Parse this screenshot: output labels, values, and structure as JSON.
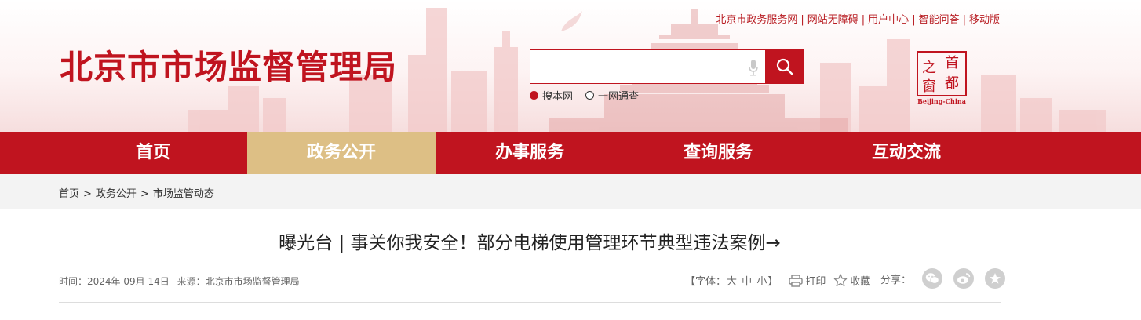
{
  "header": {
    "site_title": "北京市市场监督管理局",
    "top_links": [
      "北京市政务服务网",
      "网站无障碍",
      "用户中心",
      "智能问答",
      "移动版"
    ],
    "search": {
      "placeholder": "",
      "scopes": [
        {
          "label": "搜本网",
          "selected": true
        },
        {
          "label": "一网通查",
          "selected": false
        }
      ]
    },
    "capital_logo": {
      "chars": [
        "首",
        "都",
        "之",
        "窗"
      ],
      "caption": "Beijing-China"
    }
  },
  "nav": {
    "items": [
      {
        "label": "首页",
        "active": false
      },
      {
        "label": "政务公开",
        "active": true
      },
      {
        "label": "办事服务",
        "active": false
      },
      {
        "label": "查询服务",
        "active": false
      },
      {
        "label": "互动交流",
        "active": false
      }
    ]
  },
  "breadcrumb": {
    "items": [
      "首页",
      "政务公开",
      "市场监管动态"
    ],
    "separator": ">"
  },
  "article": {
    "title": "曝光台 | 事关你我安全！部分电梯使用管理环节典型违法案例→",
    "time_label": "时间：",
    "time_value": "2024年 09月 14日",
    "source_label": "来源：",
    "source_value": "北京市市场监督管理局"
  },
  "tools": {
    "font_prefix": "【字体：",
    "font_sizes": [
      "大",
      "中",
      "小"
    ],
    "font_suffix": "】",
    "print_label": "打印",
    "favorite_label": "收藏",
    "share_label": "分享："
  },
  "colors": {
    "brand_red": "#c0141f",
    "nav_active": "#ddbf85",
    "crumb_bg": "#f3f3f3"
  },
  "icons": [
    "search-icon",
    "microphone-icon",
    "print-icon",
    "star-icon",
    "wechat-icon",
    "weibo-icon",
    "qzone-icon"
  ]
}
